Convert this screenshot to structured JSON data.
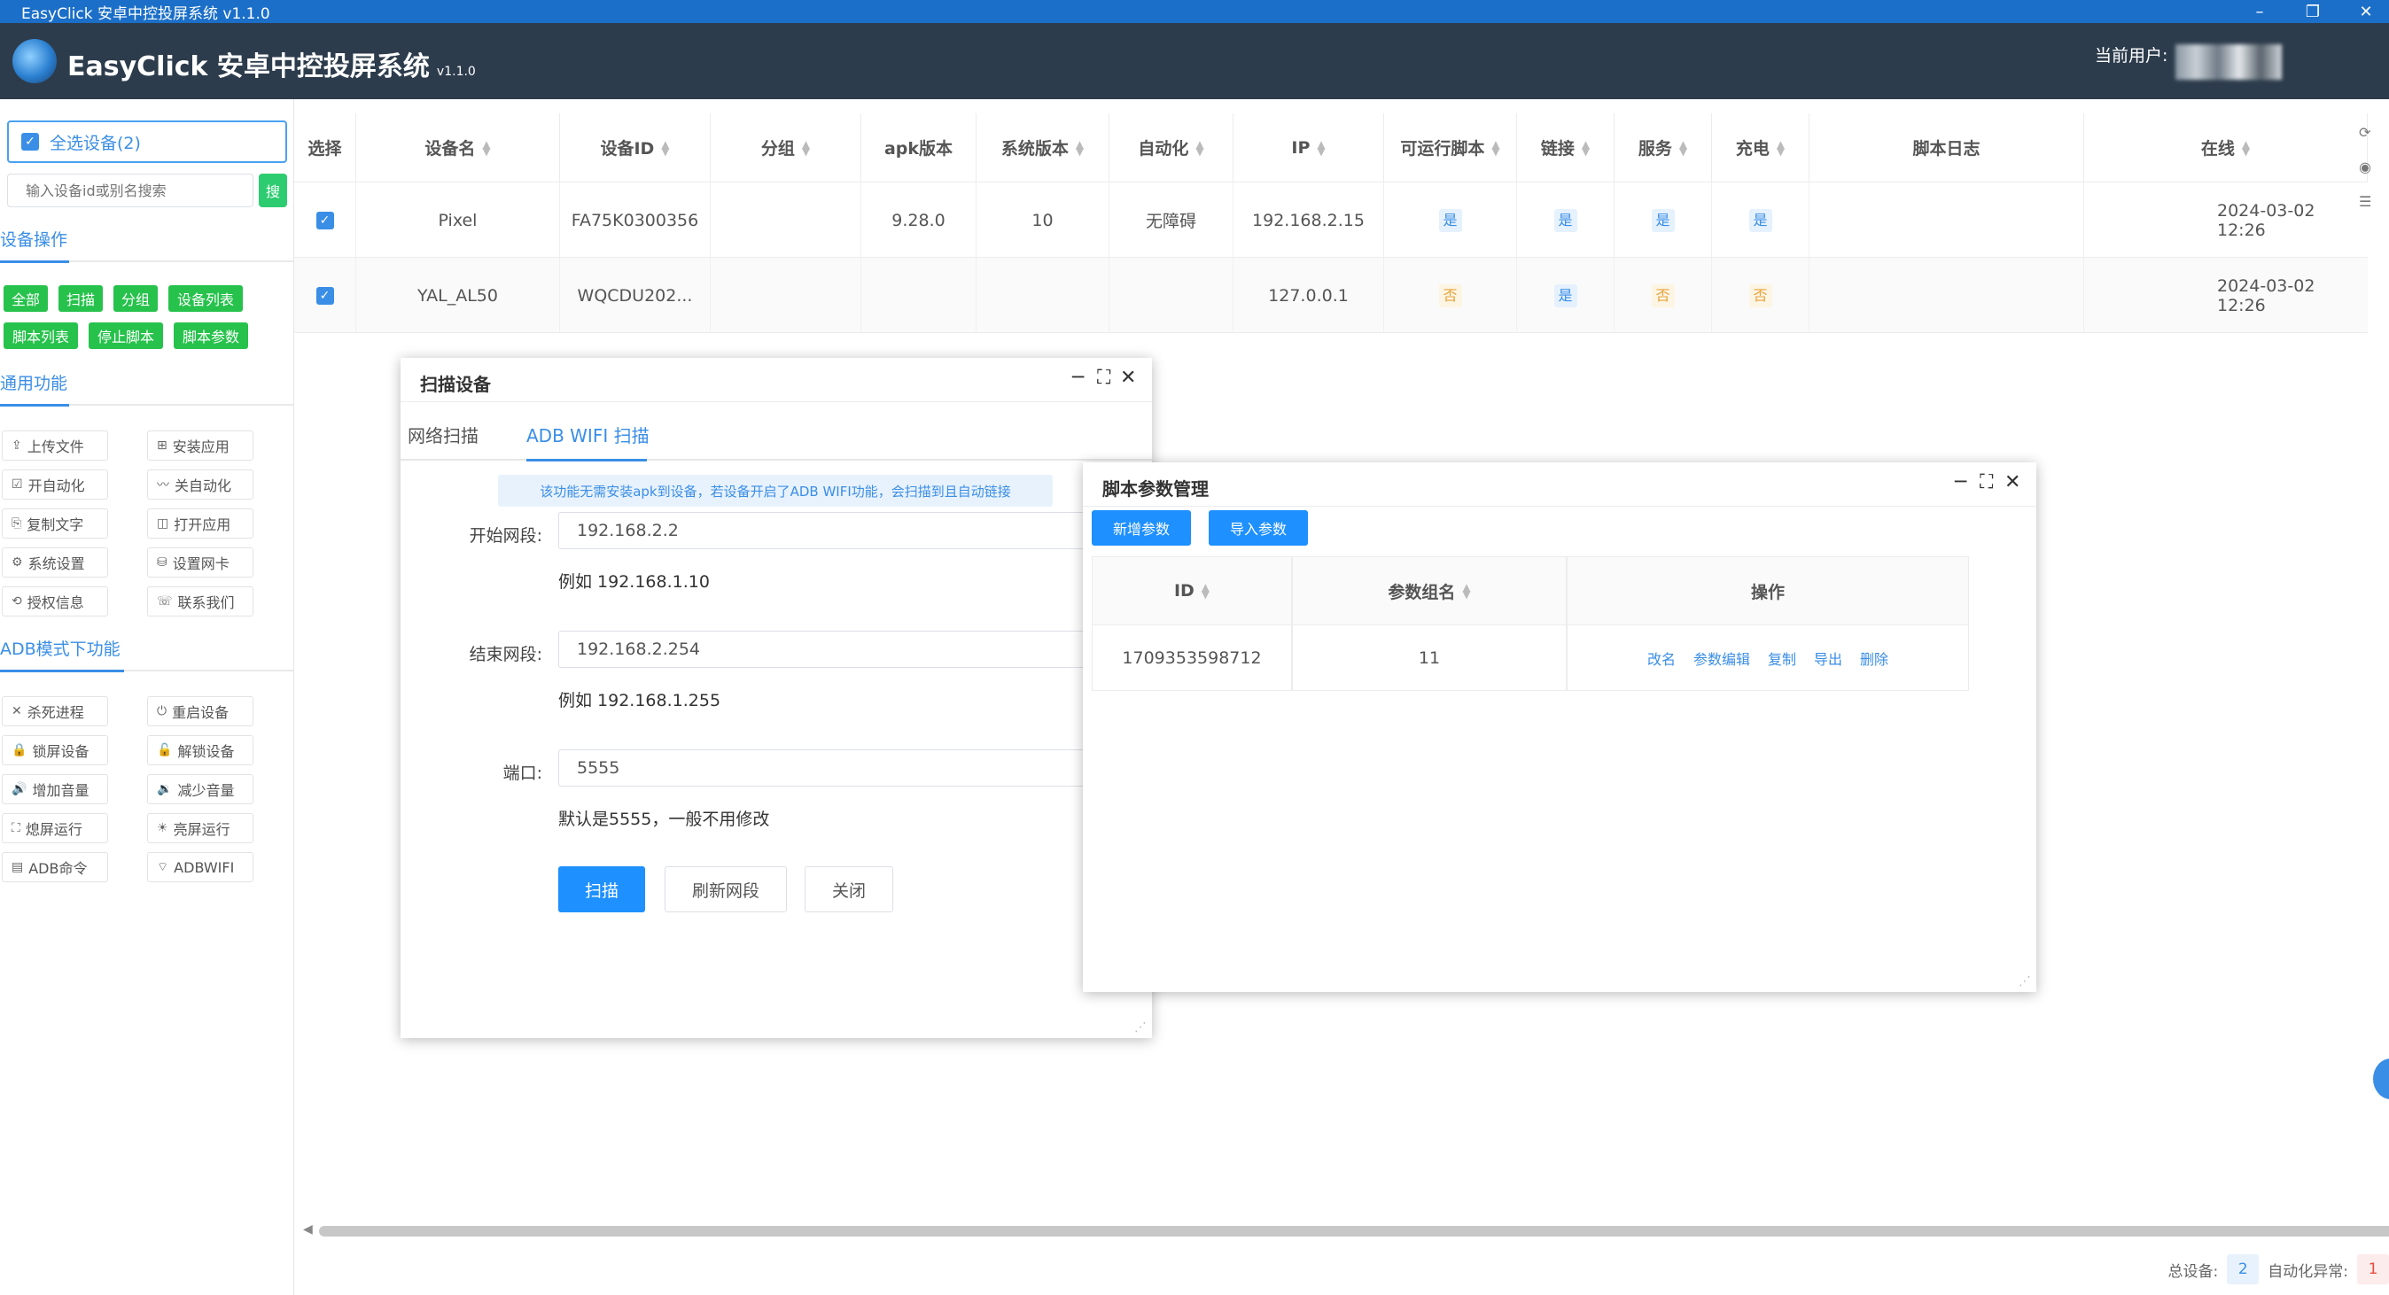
{
  "os_titlebar": {
    "title": "EasyClick 安卓中控投屏系统 v1.1.0",
    "minimize": "–",
    "restore": "❐",
    "close": "✕"
  },
  "header": {
    "app_name": "EasyClick 安卓中控投屏系统",
    "version": "v1.1.0",
    "current_user_label": "当前用户:"
  },
  "sidebar": {
    "select_all_label": "全选设备(2)",
    "search_placeholder": "输入设备id或别名搜索",
    "search_button": "搜",
    "device_ops_title": "设备操作",
    "device_ops_buttons": [
      "全部",
      "扫描",
      "分组",
      "设备列表",
      "脚本列表",
      "停止脚本",
      "脚本参数"
    ],
    "general_title": "通用功能",
    "general_buttons": [
      {
        "icon": "upload-icon",
        "glyph": "⇪",
        "label": "上传文件"
      },
      {
        "icon": "install-icon",
        "glyph": "⊞",
        "label": "安装应用"
      },
      {
        "icon": "enable-automation-icon",
        "glyph": "☑",
        "label": "开自动化"
      },
      {
        "icon": "disable-automation-icon",
        "glyph": "〰",
        "label": "关自动化"
      },
      {
        "icon": "copy-icon",
        "glyph": "⎘",
        "label": "复制文字"
      },
      {
        "icon": "open-app-icon",
        "glyph": "◫",
        "label": "打开应用"
      },
      {
        "icon": "settings-icon",
        "glyph": "⚙",
        "label": "系统设置"
      },
      {
        "icon": "network-card-icon",
        "glyph": "⛁",
        "label": "设置网卡"
      },
      {
        "icon": "license-icon",
        "glyph": "⟲",
        "label": "授权信息"
      },
      {
        "icon": "contact-icon",
        "glyph": "☏",
        "label": "联系我们"
      }
    ],
    "adb_title": "ADB模式下功能",
    "adb_buttons": [
      {
        "icon": "kill-process-icon",
        "glyph": "✕",
        "label": "杀死进程"
      },
      {
        "icon": "power-icon",
        "glyph": "⏻",
        "label": "重启设备"
      },
      {
        "icon": "lock-icon",
        "glyph": "🔒",
        "label": "锁屏设备"
      },
      {
        "icon": "unlock-icon",
        "glyph": "🔓",
        "label": "解锁设备"
      },
      {
        "icon": "volume-up-icon",
        "glyph": "🔊",
        "label": "增加音量"
      },
      {
        "icon": "volume-down-icon",
        "glyph": "🔉",
        "label": "减少音量"
      },
      {
        "icon": "screen-off-icon",
        "glyph": "⛶",
        "label": "熄屏运行"
      },
      {
        "icon": "screen-on-icon",
        "glyph": "☀",
        "label": "亮屏运行"
      },
      {
        "icon": "terminal-icon",
        "glyph": "▤",
        "label": "ADB命令"
      },
      {
        "icon": "wifi-icon",
        "glyph": "⌔",
        "label": "ADBWIFI"
      }
    ]
  },
  "device_table": {
    "columns": [
      "选择",
      "设备名",
      "设备ID",
      "分组",
      "apk版本",
      "系统版本",
      "自动化",
      "IP",
      "可运行脚本",
      "链接",
      "服务",
      "充电",
      "脚本日志",
      "在线"
    ],
    "rows": [
      {
        "checked": "✓",
        "name": "Pixel",
        "id": "FA75K0300356",
        "group": "",
        "apk": "9.28.0",
        "os": "10",
        "automation": "无障碍",
        "ip": "192.168.2.15",
        "runnable": "是",
        "link": "是",
        "service": "是",
        "charging": "是",
        "log": "",
        "online": "2024-03-02 12:26"
      },
      {
        "checked": "✓",
        "name": "YAL_AL50",
        "id": "WQCDU202...",
        "group": "",
        "apk": "",
        "os": "",
        "automation": "",
        "ip": "127.0.0.1",
        "runnable": "否",
        "link": "是",
        "service": "否",
        "charging": "否",
        "log": "",
        "online": "2024-03-02 12:26"
      }
    ]
  },
  "footer": {
    "total_label": "总设备:",
    "total_value": "2",
    "auto_err_label": "自动化异常:",
    "auto_err_value": "1"
  },
  "scan_dialog": {
    "title": "扫描设备",
    "tabs": [
      "网络扫描",
      "ADB WIFI 扫描"
    ],
    "active_tab": "ADB WIFI 扫描",
    "info": "该功能无需安装apk到设备，若设备开启了ADB WIFI功能，会扫描到且自动链接",
    "start_label": "开始网段:",
    "start_value": "192.168.2.2",
    "start_hint": "例如 192.168.1.10",
    "end_label": "结束网段:",
    "end_value": "192.168.2.254",
    "end_hint": "例如 192.168.1.255",
    "port_label": "端口:",
    "port_value": "5555",
    "port_hint": "默认是5555，一般不用修改",
    "scan_btn": "扫描",
    "refresh_btn": "刷新网段",
    "close_btn": "关闭"
  },
  "param_dialog": {
    "title": "脚本参数管理",
    "add_btn": "新增参数",
    "import_btn": "导入参数",
    "columns": [
      "ID",
      "参数组名",
      "操作"
    ],
    "rows": [
      {
        "id": "1709353598712",
        "name": "11",
        "actions": [
          "改名",
          "参数编辑",
          "复制",
          "导出",
          "删除"
        ]
      }
    ]
  },
  "colors": {
    "accent": "#3a8ee6",
    "header_bg": "#2d3c4c",
    "green": "#27c24c",
    "titlebar": "#1b6fc8"
  }
}
